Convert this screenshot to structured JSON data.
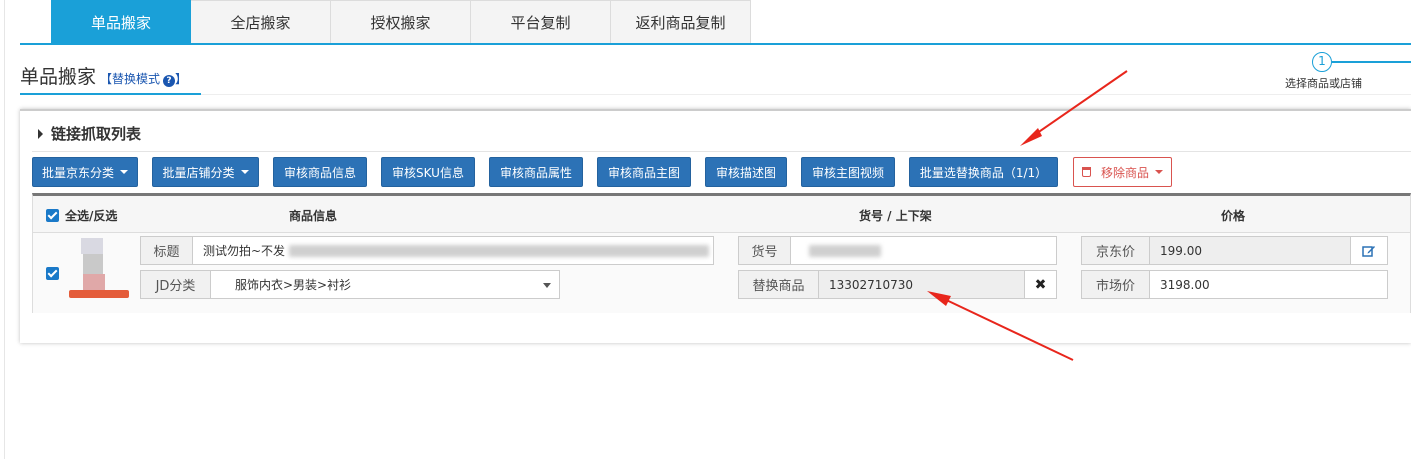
{
  "tabs": [
    {
      "label": "单品搬家",
      "active": true
    },
    {
      "label": "全店搬家"
    },
    {
      "label": "授权搬家"
    },
    {
      "label": "平台复制"
    },
    {
      "label": "返利商品复制"
    }
  ],
  "page": {
    "title": "单品搬家",
    "mode_link": "【替换模式",
    "mode_link_close": "】"
  },
  "stepper": {
    "number": "1",
    "label": "选择商品或店铺"
  },
  "panel": {
    "title": "链接抓取列表"
  },
  "toolbar": {
    "batch_jd_category": "批量京东分类",
    "batch_shop_category": "批量店铺分类",
    "audit_info": "审核商品信息",
    "audit_sku": "审核SKU信息",
    "audit_attr": "审核商品属性",
    "audit_main_img": "审核商品主图",
    "audit_desc_img": "审核描述图",
    "audit_main_video": "审核主图视频",
    "batch_select_replace": "批量选替换商品（1/1）",
    "remove_goods": "移除商品"
  },
  "table": {
    "headers": {
      "select_all": "全选/反选",
      "goods_info": "商品信息",
      "sku_shelf": "货号 / 上下架",
      "price": "价格"
    },
    "row": {
      "title_label": "标题",
      "title_value": "测试勿拍~不发",
      "jd_cat_label": "JD分类",
      "jd_cat_value": "服饰内衣>男装>衬衫",
      "sku_label": "货号",
      "replace_label": "替换商品",
      "replace_value": "13302710730",
      "jd_price_label": "京东价",
      "jd_price_value": "199.00",
      "market_price_label": "市场价",
      "market_price_value": "3198.00"
    }
  },
  "colors": {
    "accent": "#1aa0d8",
    "button": "#2c72b6",
    "danger": "#d9534f",
    "arrow": "#e8261c"
  }
}
